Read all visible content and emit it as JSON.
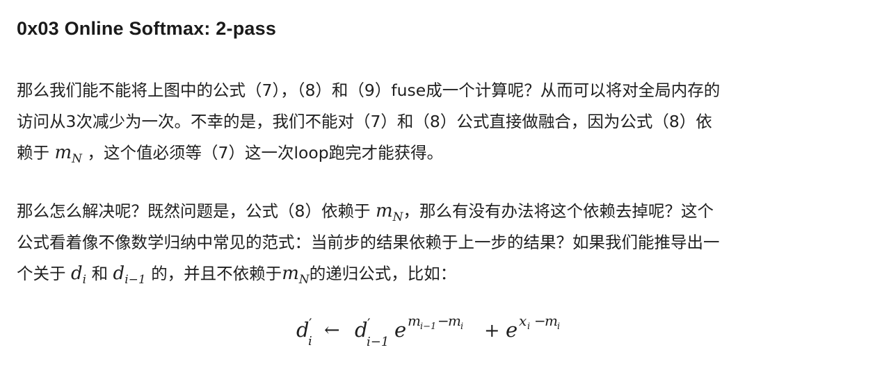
{
  "title": "0x03 Online Softmax: 2-pass",
  "paragraph1": {
    "line1": "那么我们能不能将上图中的公式（7），（8）和（9）fuse成一个计算呢？从而可以将对全局内存的",
    "line2": "访问从3次减少为一次。不幸的是，我们不能对（7）和（8）公式直接做融合，因为公式（8）依",
    "line3_pre": "赖于",
    "line3_math_var": "m",
    "line3_math_sub": "N",
    "line3_post": "，这个值必须等（7）这一次loop跑完才能获得。"
  },
  "paragraph2": {
    "line1_pre": "那么怎么解决呢？既然问题是，公式（8）依赖于",
    "line1_math_var": "m",
    "line1_math_sub": "N",
    "line1_post": "，那么有没有办法将这个依赖去掉呢？这个",
    "line2": "公式看着像不像数学归纳中常见的范式：当前步的结果依赖于上一步的结果？如果我们能推导出一",
    "line3_a": "个关于",
    "line3_math1_var": "d",
    "line3_math1_sub": "i",
    "line3_b": "和",
    "line3_math2_var": "d",
    "line3_math2_sub": "i−1",
    "line3_c": "的，并且不依赖于",
    "line3_math3_var": "m",
    "line3_math3_sub": "N",
    "line3_d": "的递归公式，比如："
  },
  "formula": {
    "lhs_var": "d",
    "lhs_prime": "′",
    "lhs_sub": "i",
    "arrow": "←",
    "rhs1_var": "d",
    "rhs1_prime": "′",
    "rhs1_sub": "i−1",
    "exp_base": "e",
    "exp1_a": "m",
    "exp1_a_sub": "i−1",
    "exp1_minus": "−",
    "exp1_b": "m",
    "exp1_b_sub": "i",
    "plus": "+",
    "exp2_a": "x",
    "exp2_a_sub": "i",
    "exp2_minus": "−",
    "exp2_b": "m",
    "exp2_b_sub": "i"
  }
}
